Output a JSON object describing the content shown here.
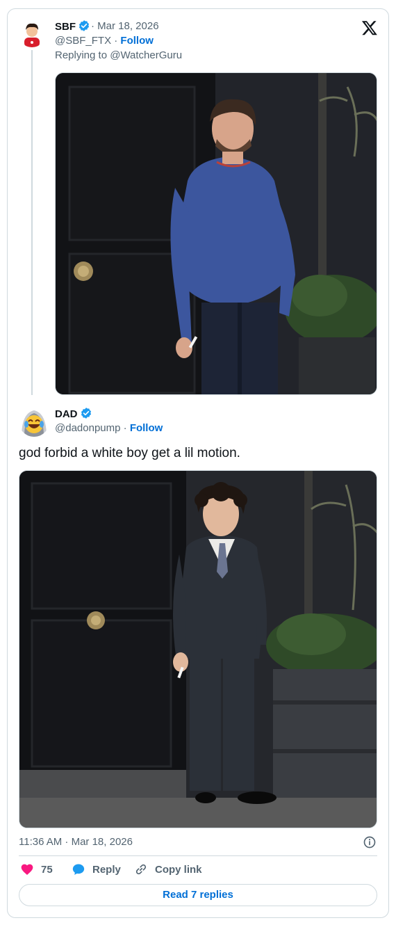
{
  "parent_tweet": {
    "name": "SBF",
    "date": "· Mar 18, 2026",
    "handle": "@SBF_FTX",
    "follow_label": "Follow",
    "replying_to": "Replying to @WatcherGuru"
  },
  "main_tweet": {
    "name": "DAD",
    "handle": "@dadonpump",
    "follow_label": "Follow",
    "text": "god forbid a white boy get a lil motion.",
    "timestamp": "11:36 AM · Mar 18, 2026"
  },
  "actions": {
    "likes_count": "75",
    "reply_label": "Reply",
    "copy_link_label": "Copy link",
    "read_replies_label": "Read 7 replies"
  },
  "colors": {
    "link_blue": "#006fd6",
    "verified_blue": "#1d9bf0",
    "like_pink": "#f91880",
    "muted": "#536471",
    "border": "#cfd9de"
  },
  "icons": [
    "x-logo-icon",
    "verified-badge-icon",
    "heart-icon",
    "reply-bubble-icon",
    "link-icon",
    "info-icon"
  ]
}
